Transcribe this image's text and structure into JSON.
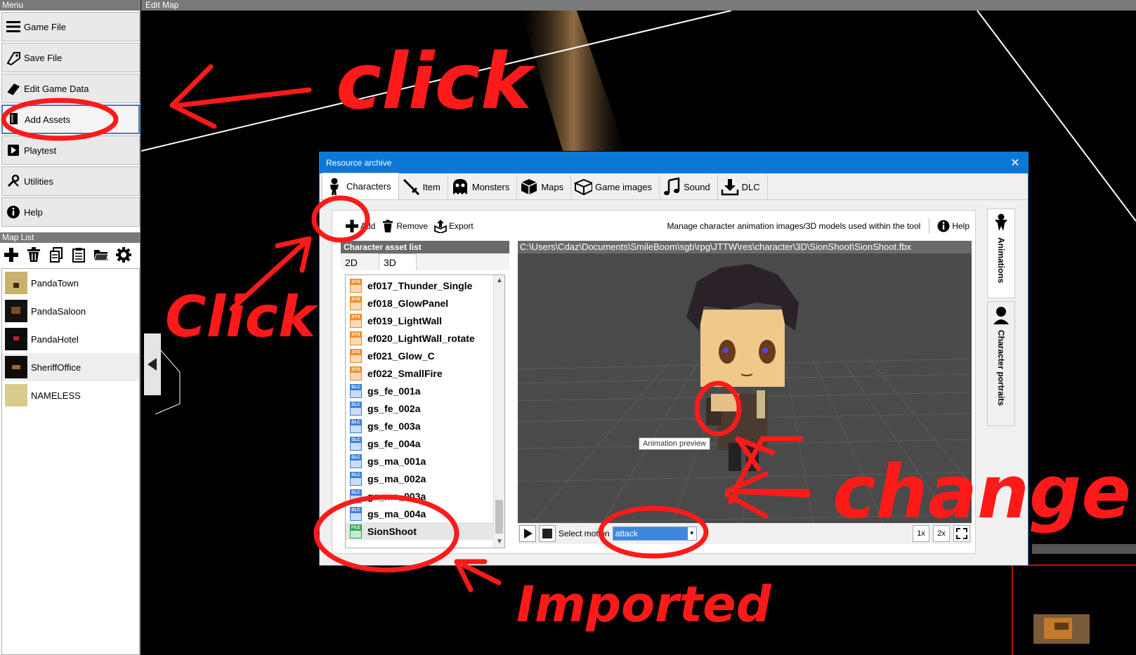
{
  "menu": {
    "title": "Menu",
    "items": [
      {
        "label": "Game File",
        "icon": "hamburger-icon"
      },
      {
        "label": "Save File",
        "icon": "save-tag-icon"
      },
      {
        "label": "Edit Game Data",
        "icon": "book-icon"
      },
      {
        "label": "Add Assets",
        "icon": "asset-book-icon"
      },
      {
        "label": "Playtest",
        "icon": "play-icon"
      },
      {
        "label": "Utilities",
        "icon": "tools-icon"
      },
      {
        "label": "Help",
        "icon": "info-icon"
      }
    ]
  },
  "map_list": {
    "title": "Map List",
    "tools": [
      "add-icon",
      "trash-icon",
      "copy-icon",
      "clipboard-icon",
      "folder-icon",
      "gear-icon"
    ],
    "items": [
      {
        "name": "PandaTown",
        "thumb_color": "#c8b16a"
      },
      {
        "name": "PandaSaloon",
        "thumb_color": "#2a1a0a"
      },
      {
        "name": "PandaHotel",
        "thumb_color": "#1a0a0a"
      },
      {
        "name": "SheriffOffice",
        "thumb_color": "#1a1208"
      },
      {
        "name": "NAMELESS",
        "thumb_color": "#d8cc8c"
      }
    ]
  },
  "edit_map": {
    "title": "Edit Map"
  },
  "dialog": {
    "title": "Resource archive",
    "close": "✕",
    "tabs": [
      {
        "label": "Characters",
        "icon": "character-icon"
      },
      {
        "label": "Item",
        "icon": "sword-icon"
      },
      {
        "label": "Monsters",
        "icon": "ghost-icon"
      },
      {
        "label": "Maps",
        "icon": "map-box-icon"
      },
      {
        "label": "Game images",
        "icon": "image-box-icon"
      },
      {
        "label": "Sound",
        "icon": "music-note-icon"
      },
      {
        "label": "DLC",
        "icon": "download-icon"
      }
    ],
    "toolbar": {
      "add": "Add",
      "remove": "Remove",
      "export": "Export",
      "manage_text": "Manage character animation images/3D models used within the tool",
      "help": "Help"
    },
    "asset_list": {
      "title": "Character asset list",
      "subtabs": [
        "2D",
        "3D"
      ],
      "items": [
        {
          "name": "ef017_Thunder_Single",
          "badge": "SYS"
        },
        {
          "name": "ef018_GlowPanel",
          "badge": "SYS"
        },
        {
          "name": "ef019_LightWall",
          "badge": "SYS"
        },
        {
          "name": "ef020_LightWall_rotate",
          "badge": "SYS"
        },
        {
          "name": "ef021_Glow_C",
          "badge": "SYS"
        },
        {
          "name": "ef022_SmallFire",
          "badge": "SYS"
        },
        {
          "name": "gs_fe_001a",
          "badge": "DLC"
        },
        {
          "name": "gs_fe_002a",
          "badge": "DLC"
        },
        {
          "name": "gs_fe_003a",
          "badge": "DLC"
        },
        {
          "name": "gs_fe_004a",
          "badge": "DLC"
        },
        {
          "name": "gs_ma_001a",
          "badge": "DLC"
        },
        {
          "name": "gs_ma_002a",
          "badge": "DLC"
        },
        {
          "name": "gs_ma_003a",
          "badge": "DLC"
        },
        {
          "name": "gs_ma_004a",
          "badge": "DLC"
        },
        {
          "name": "SionShoot",
          "badge": "FILE"
        }
      ]
    },
    "preview": {
      "path": "C:\\Users\\Cdaz\\Documents\\SmileBoom\\sgb\\rpg\\JTTW\\res\\character\\3D\\SionShoot\\SionShoot.fbx",
      "tooltip": "Animation preview",
      "motion_label": "Select motion",
      "motion_value": "attack",
      "zoom": [
        "1x",
        "2x"
      ]
    },
    "side_tabs": [
      {
        "label": "Animations",
        "icon": "figure-icon"
      },
      {
        "label": "Character portraits",
        "icon": "bust-icon"
      }
    ]
  },
  "annotations": {
    "click_top": "click",
    "click_mid": "Click",
    "change": "change?",
    "imported": "Imported",
    "color": "#ff1a1a"
  }
}
